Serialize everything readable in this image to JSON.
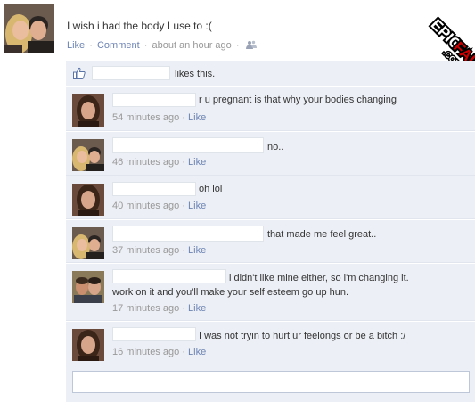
{
  "post": {
    "text": "I wish i had the body I use to :(",
    "like_label": "Like",
    "comment_label": "Comment",
    "time": "about an hour ago",
    "separator": "·"
  },
  "likes": {
    "text": "likes this."
  },
  "comments": [
    {
      "text": "r u pregnant is that why your bodies changing",
      "time": "54 minutes ago",
      "like_label": "Like"
    },
    {
      "text": "no..",
      "time": "46 minutes ago",
      "like_label": "Like"
    },
    {
      "text": "oh lol",
      "time": "40 minutes ago",
      "like_label": "Like"
    },
    {
      "text": "that made me feel great..",
      "time": "37 minutes ago",
      "like_label": "Like"
    },
    {
      "text": "i didn't like mine either, so i'm changing it.",
      "text_line2": "work on it and you'll make your self esteem go up hun.",
      "time": "17 minutes ago",
      "like_label": "Like"
    },
    {
      "text": "I was not tryin to hurt ur feelongs or be a bitch :/",
      "time": "16 minutes ago",
      "like_label": "Like"
    }
  ],
  "watermark": {
    "line1": "EPIC",
    "line2": "FAIL",
    "line3": ".COM"
  },
  "colors": {
    "link": "#6d84b4",
    "comment_bg": "#eceff5",
    "muted": "#999999",
    "watermark_red": "#cc0000"
  },
  "icons": {
    "like": "thumbs-up-icon",
    "privacy": "friends-icon"
  }
}
